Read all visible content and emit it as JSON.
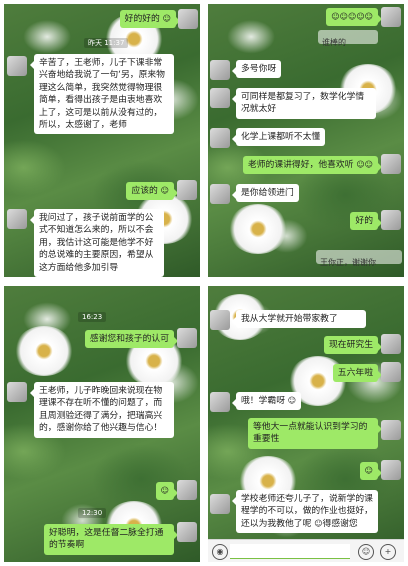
{
  "panel1": {
    "top_bubble": "好的好的",
    "timestamp": "昨天 11:37",
    "msg1": "辛苦了，王老师，儿子下课非常兴奋地给我说了一句‘另，原来物理这么简单，我突然觉得物理很简单，看得出孩子是由衷地喜欢上了，这可是以前从没有过的，所以，太感谢了，老师",
    "reply1": "应该的",
    "msg2": "我问过了，孩子说前面学的公式不知道怎么来的，所以不会用，我估计这可能是他学不好的总说难的主要原因，希望从这方面给他多加引导"
  },
  "panel2": {
    "top_bubble": "",
    "top_blur_text": "谁棒的",
    "msg1": "多号你呀",
    "msg2": "可同样是都复习了，数学化学情况就太好",
    "msg3": "化学上课都听不太懂",
    "reply1": "老师的课讲得好，他喜欢听",
    "msg4": "是你给领进门",
    "reply2": "好的",
    "bottom_blur": "王你正，谢谢你"
  },
  "panel3": {
    "timestamp": "16:23",
    "reply1": "感谢您和孩子的认可",
    "msg1": "王老师，儿子昨晚回来说现在物理课不存在听不懂的问题了，而且周测验还得了满分，把瑞高兴的，感谢你给了他兴趣与信心！",
    "timestamp2": "12:30",
    "reply2": "好聪明，这是任督二脉全打通的节奏啊"
  },
  "panel4": {
    "msg1": "我从大学就开始带家教了",
    "reply1": "现在研究生",
    "reply2": "五六年啦",
    "msg2": "哦！学霸呀",
    "reply3": "等他大一点就能认识到学习的重要性",
    "msg3": "学校老师还夸儿子了，说新学的课程学的不可以，做的作业也挺好，还以为我教他了呢",
    "msg3_tail": "得感谢您"
  },
  "icons": {
    "emoji": "smile-icon",
    "voice": "voice-icon",
    "plus": "plus-icon"
  },
  "colors": {
    "out_bubble": "#9ee967",
    "in_bubble": "#ffffff"
  }
}
